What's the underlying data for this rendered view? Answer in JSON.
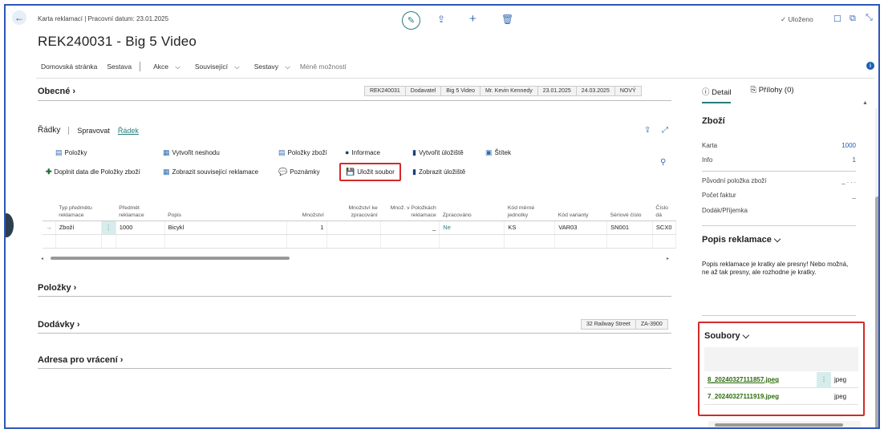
{
  "header": {
    "breadcrumb": "Karta reklamací | Pracovní datum: 23.01.2025",
    "title": "REK240031 - Big 5 Video",
    "saved_label": "Uloženo"
  },
  "action_bar": {
    "items": [
      "Domovská stránka",
      "Sestava",
      "Akce",
      "Související",
      "Sestavy",
      "Méně možností"
    ]
  },
  "general": {
    "title": "Obecné",
    "chips": [
      "REK240031",
      "Dodavatel",
      "Big 5 Video",
      "Mr. Kevin Kennedy",
      "23.01.2025",
      "24.03.2025",
      "NOVÝ"
    ]
  },
  "lines": {
    "title": "Řádky",
    "tabs": [
      "Spravovat",
      "Řádek"
    ],
    "commands_row1": [
      "Položky",
      "Vytvořit neshodu",
      "Položky zboží",
      "Informace",
      "Vytvořit úložiště",
      "Štítek"
    ],
    "commands_row2": [
      "Doplnit data dle Položky zboží",
      "Zobrazit související reklamace",
      "Poznámky",
      "Uložit soubor",
      "Zobrazit úložiště"
    ],
    "columns": [
      "Typ předmětu reklamace",
      "Předmět reklamace",
      "Popis",
      "Množství",
      "Množství ke zpracování",
      "Množ. v Položkách reklamace",
      "Zpracováno",
      "Kód měrné jednotky",
      "Kód varianty",
      "Sériové číslo",
      "Číslo dá"
    ],
    "rows": [
      {
        "type": "Zboží",
        "item": "1000",
        "desc": "Bicykl",
        "qty": "1",
        "qty_proc": "",
        "qty_items": "_",
        "processed": "Ne",
        "uom": "KS",
        "variant": "VAR03",
        "serial": "SN001",
        "lot": "SCX0"
      }
    ]
  },
  "sections": {
    "items": "Položky",
    "deliveries": "Dodávky",
    "deliveries_chips": [
      "32 Railway Street",
      "ZA-3900"
    ],
    "return_address": "Adresa pro vrácení"
  },
  "factbox": {
    "tab_detail": "Detail",
    "tab_attachments": "Přílohy (0)",
    "goods_title": "Zboží",
    "fields": [
      {
        "label": "Karta",
        "value": "1000"
      },
      {
        "label": "Info",
        "value": "1"
      },
      {
        "label": "Původní položka zboží",
        "value": "_ . . ."
      },
      {
        "label": "Počet faktur",
        "value": "_"
      },
      {
        "label": "Dodák/Příjemka",
        "value": ""
      }
    ],
    "complaint_desc_title": "Popis reklamace",
    "complaint_desc_text": "Popis reklamace je kratky ale presny! Nebo možná, ne až tak presny, ale rozhodne je kratky.",
    "files_title": "Soubory",
    "files": [
      {
        "name": "8_20240327111857.jpeg",
        "ext": "jpeg"
      },
      {
        "name": "7_20240327111919.jpeg",
        "ext": "jpeg"
      }
    ]
  },
  "colors": {
    "accent": "#1a5fb4",
    "teal": "#2a7c7c",
    "highlight": "#d42a2a",
    "link_green": "#2a6a0a"
  }
}
